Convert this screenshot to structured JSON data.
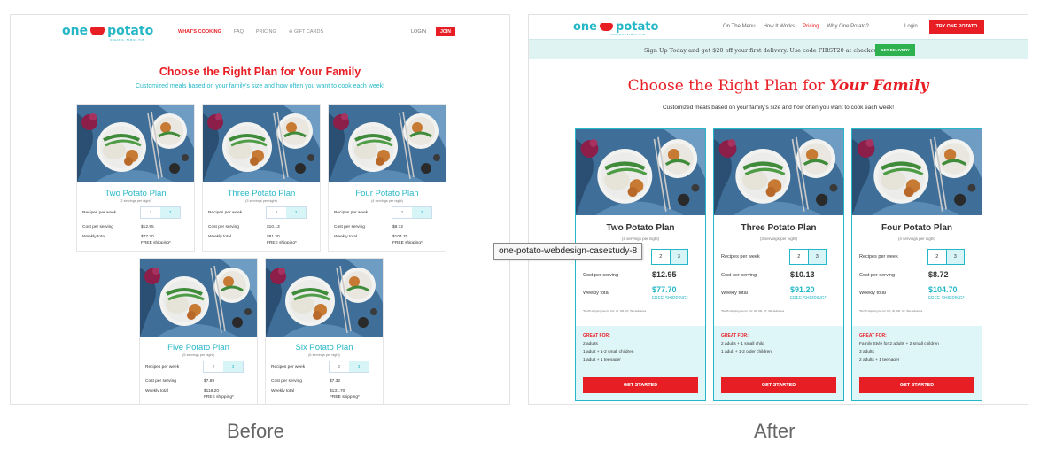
{
  "before": {
    "nav": {
      "logo_left": "one",
      "logo_right": "potato",
      "logo_tag": "ORGANIC. FAMILY. FUN.",
      "links": [
        "WHAT'S COOKING",
        "FAQ",
        "PRICING",
        "GIFT CARDS"
      ],
      "login": "LOGIN",
      "join": "JOIN"
    },
    "title": "Choose the Right Plan for Your Family",
    "subtitle": "Customized meals based on your family's size and how often you want to cook each week!",
    "labels": {
      "recipes": "Recipes per week",
      "cost": "Cost per serving",
      "weekly": "Weekly total",
      "free": "FREE shipping*"
    },
    "options": [
      "2",
      "3"
    ],
    "plans": [
      {
        "name": "Two Potato Plan",
        "servings": "(2 servings per night)",
        "cost": "$12.95",
        "weekly": "$77.70"
      },
      {
        "name": "Three Potato Plan",
        "servings": "(3 servings per night)",
        "cost": "$10.13",
        "weekly": "$91.20"
      },
      {
        "name": "Four Potato Plan",
        "servings": "(4 servings per night)",
        "cost": "$8.72",
        "weekly": "$104.70"
      },
      {
        "name": "Five Potato Plan",
        "servings": "(5 servings per night)",
        "cost": "$7.89",
        "weekly": "$118.20"
      },
      {
        "name": "Six Potato Plan",
        "servings": "(6 servings per night)",
        "cost": "$7.32",
        "weekly": "$131.70"
      }
    ]
  },
  "after": {
    "nav": {
      "logo_left": "one",
      "logo_right": "potato",
      "logo_tag": "ORGANIC. FAMILY. FUN.",
      "links": [
        "On The Menu",
        "How It Works",
        "Pricing",
        "Why One Potato?"
      ],
      "login": "Login",
      "try": "TRY ONE POTATO"
    },
    "banner": {
      "text": "Sign Up Today and get $20 off your first delivery. Use code FIRST20 at checkout.",
      "button": "GET DELIVERY"
    },
    "title_plain": "Choose the Right Plan for",
    "title_script": "Your Family",
    "subtitle": "Customized meals based on your family's size and how often you want to cook each week!",
    "labels": {
      "recipes": "Recipes per week",
      "cost": "Cost per serving",
      "weekly": "Weekly total",
      "free": "FREE SHIPPING*",
      "great": "GREAT FOR:",
      "cta": "GET STARTED"
    },
    "fine_print": "*$4.95 shipping fee for CO, ID, OR, UT, WA deliveries",
    "options": [
      "2",
      "3"
    ],
    "plans": [
      {
        "name": "Two Potato Plan",
        "servings": "(2 servings per night)",
        "cost": "$12.95",
        "weekly": "$77.70",
        "great": [
          "2 adults",
          "1 adult + 1-2 small children",
          "1 adult + 1 teenager"
        ]
      },
      {
        "name": "Three Potato Plan",
        "servings": "(3 servings per night)",
        "cost": "$10.13",
        "weekly": "$91.20",
        "great": [
          "2 adults + 1 small child",
          "1 adult + 1-2 older children"
        ]
      },
      {
        "name": "Four Potato Plan",
        "servings": "(4 servings per night)",
        "cost": "$8.72",
        "weekly": "$104.70",
        "great": [
          "Family Style for 2 adults + 2 small children",
          "3 adults",
          "2 adults + 1 teenager"
        ]
      }
    ]
  },
  "captions": {
    "before": "Before",
    "after": "After"
  },
  "tooltip": "one-potato-webdesign-casestudy-8",
  "colors": {
    "red": "#e81e25",
    "teal": "#26b7c6",
    "green": "#2db24f"
  }
}
